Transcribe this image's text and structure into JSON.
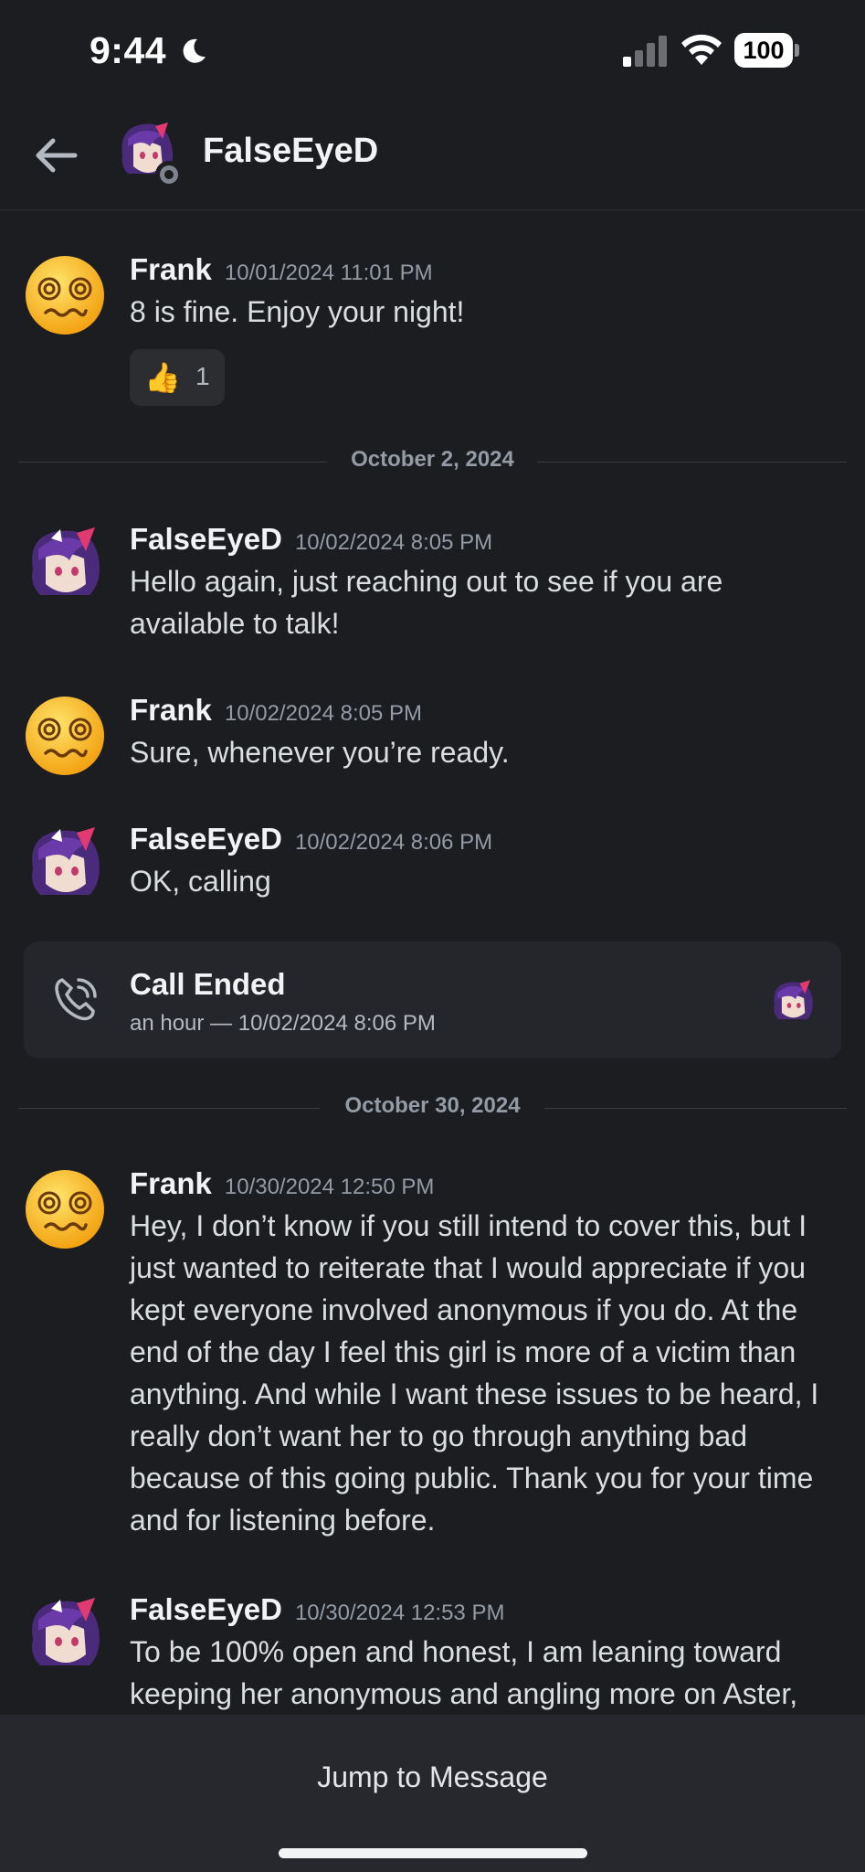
{
  "status_bar": {
    "time": "9:44",
    "battery": "100"
  },
  "header": {
    "title": "FalseEyeD"
  },
  "messages": [
    {
      "author": "Frank",
      "time": "10/01/2024 11:01 PM",
      "text": "8 is fine. Enjoy your night!",
      "avatar_icon": "dizzy-face-emoji"
    },
    {
      "author": "FalseEyeD",
      "time": "10/02/2024 8:05 PM",
      "text": "Hello again, just reaching out to see if you are available to talk!",
      "avatar_icon": "anime-avatar"
    },
    {
      "author": "Frank",
      "time": "10/02/2024 8:05 PM",
      "text": "Sure, whenever you’re ready.",
      "avatar_icon": "dizzy-face-emoji"
    },
    {
      "author": "FalseEyeD",
      "time": "10/02/2024 8:06 PM",
      "text": "OK, calling",
      "avatar_icon": "anime-avatar"
    },
    {
      "author": "Frank",
      "time": "10/30/2024 12:50 PM",
      "text": "Hey, I don’t know if you still intend to cover this, but I just wanted to reiterate that I would appreciate if you kept everyone involved anonymous if you do. At the end of the day I feel this girl is more of a victim than anything. And while I want these issues to be heard, I really don’t want her to go through anything bad because of this going public. Thank you for your time and for listening before.",
      "avatar_icon": "dizzy-face-emoji"
    },
    {
      "author": "FalseEyeD",
      "time": "10/30/2024 12:53 PM",
      "text": "To be 100% open and honest, I am leaning toward keeping her anonymous and angling more on Aster,",
      "avatar_icon": "anime-avatar"
    }
  ],
  "reaction": {
    "emoji": "👍",
    "count": "1"
  },
  "dividers": [
    "October 2, 2024",
    "October 30, 2024"
  ],
  "call": {
    "title": "Call Ended",
    "subtitle": "an hour — 10/02/2024 8:06 PM"
  },
  "jump": {
    "label": "Jump to Message"
  },
  "colors": {
    "background": "#1c1d21",
    "card": "#25262b",
    "muted": "#949ba4",
    "author": "#f2f3f5"
  }
}
